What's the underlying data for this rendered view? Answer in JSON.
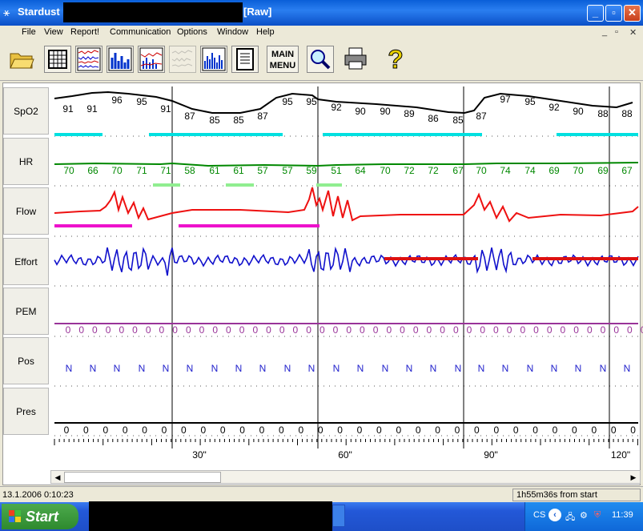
{
  "window": {
    "app_name": "Stardust",
    "title_suffix": "[Raw]",
    "minimize": "_",
    "maximize": "▫",
    "close": "✕"
  },
  "menu": {
    "items": [
      "File",
      "View",
      "Report!",
      "Communication",
      "Options",
      "Window",
      "Help"
    ],
    "mdi_minimize": "_",
    "mdi_restore": "▫",
    "mdi_close": "✕"
  },
  "toolbar": {
    "main_menu_label": "MAIN MENU",
    "help_glyph": "?"
  },
  "channels": [
    "SpO2",
    "HR",
    "Flow",
    "Effort",
    "PEM",
    "Pos",
    "Pres"
  ],
  "spo2_values": [
    "91",
    "91",
    "96",
    "95",
    "91",
    "87",
    "85",
    "85",
    "87",
    "95",
    "95",
    "92",
    "90",
    "90",
    "89",
    "86",
    "85",
    "87",
    "97",
    "95",
    "92",
    "90",
    "88",
    "88"
  ],
  "hr_values": [
    "70",
    "66",
    "70",
    "71",
    "71",
    "58",
    "61",
    "61",
    "57",
    "57",
    "59",
    "51",
    "64",
    "70",
    "72",
    "72",
    "67",
    "70",
    "74",
    "74",
    "69",
    "70",
    "69",
    "67"
  ],
  "pem_value": "0",
  "pos_value": "N",
  "pres_value": "0",
  "time_axis": [
    "30\"",
    "60\"",
    "90\"",
    "120\""
  ],
  "status": {
    "datetime": "13.1.2006 0:10:23",
    "elapsed": "1h55m36s from start"
  },
  "taskbar": {
    "start_label": "Start",
    "lang": "CS",
    "clock": "11:39"
  },
  "colors": {
    "spo2": "#000000",
    "spo2_events": "#00e0e0",
    "hr": "#008800",
    "hr_events": "#90ee90",
    "flow": "#ee1111",
    "flow_events": "#ee11cc",
    "effort": "#1111cc",
    "effort_events": "#dd1111",
    "pem": "#993399",
    "pos": "#2222cc"
  }
}
